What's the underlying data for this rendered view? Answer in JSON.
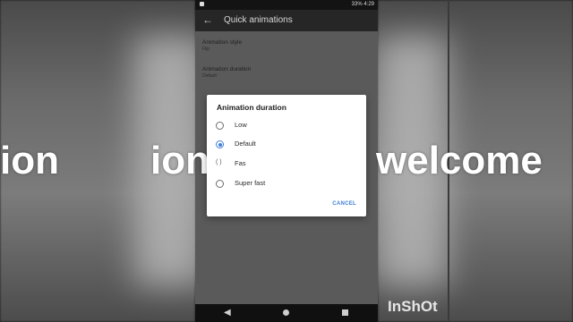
{
  "status_bar": {
    "text": "33% 4:29"
  },
  "app_bar": {
    "back_icon": "arrow-left-icon",
    "title": "Quick animations"
  },
  "settings": [
    {
      "title": "Animation style",
      "summary": "Flip"
    },
    {
      "title": "Animation duration",
      "summary": "Default"
    }
  ],
  "dialog": {
    "title": "Animation duration",
    "options": [
      {
        "label": "Low",
        "state": "unselected"
      },
      {
        "label": "Default",
        "state": "selected"
      },
      {
        "label": "Fas",
        "state": "partial"
      },
      {
        "label": "Super fast",
        "state": "unselected"
      }
    ],
    "cancel_label": "CANCEL"
  },
  "overlay": {
    "left": "ion",
    "middle": "ion re",
    "right": "welcome"
  },
  "watermark": "InShOt",
  "colors": {
    "accent": "#3f7fd6",
    "dialog_bg": "#ffffff",
    "app_bar": "#262626"
  }
}
